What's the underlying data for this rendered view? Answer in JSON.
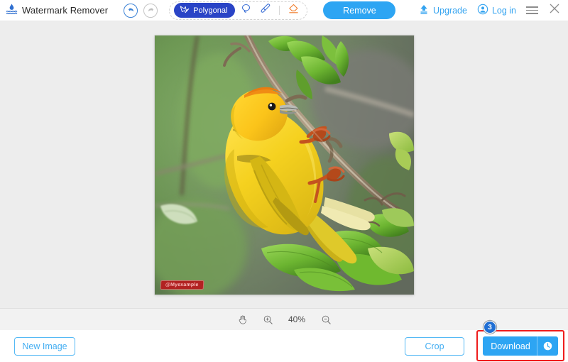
{
  "app": {
    "title": "Watermark Remover",
    "logo_icon": "watermark-droplet-icon"
  },
  "header": {
    "undo": {
      "label": "Undo",
      "icon": "undo-arrow-icon",
      "enabled": true
    },
    "redo": {
      "label": "Redo",
      "icon": "redo-arrow-icon",
      "enabled": false
    },
    "tools": [
      {
        "id": "polygonal",
        "label": "Polygonal",
        "icon": "polygonal-lasso-icon",
        "selected": true
      },
      {
        "id": "lasso",
        "label": "Lasso",
        "icon": "lasso-icon",
        "selected": false
      },
      {
        "id": "brush",
        "label": "Brush",
        "icon": "brush-icon",
        "selected": false
      },
      {
        "id": "eraser",
        "label": "Eraser",
        "icon": "eraser-icon",
        "selected": false
      }
    ],
    "remove_label": "Remove",
    "upgrade_label": "Upgrade",
    "upgrade_icon": "upload-upgrade-icon",
    "login_label": "Log in",
    "login_icon": "user-account-icon",
    "menu_icon": "hamburger-menu-icon",
    "close_icon": "close-x-icon"
  },
  "canvas": {
    "image_alt": "Yellow weaver bird perched on a branch with green leaves",
    "watermark_text": "@Myexample",
    "watermark_color": "#b22222"
  },
  "zoombar": {
    "hand_icon": "hand-pan-icon",
    "zoom_in_icon": "zoom-in-icon",
    "zoom_out_icon": "zoom-out-icon",
    "zoom_level": "40%"
  },
  "footer": {
    "new_image_label": "New Image",
    "crop_label": "Crop",
    "download_label": "Download",
    "download_history_icon": "clock-history-icon",
    "step_badge": "3",
    "highlight_color": "#ef1c1c"
  },
  "colors": {
    "accent_blue": "#2da5f3",
    "tool_blue": "#2a44c6",
    "link_blue": "#33a3f0",
    "eraser_orange": "#f07c2b",
    "canvas_bg": "#ededed"
  }
}
